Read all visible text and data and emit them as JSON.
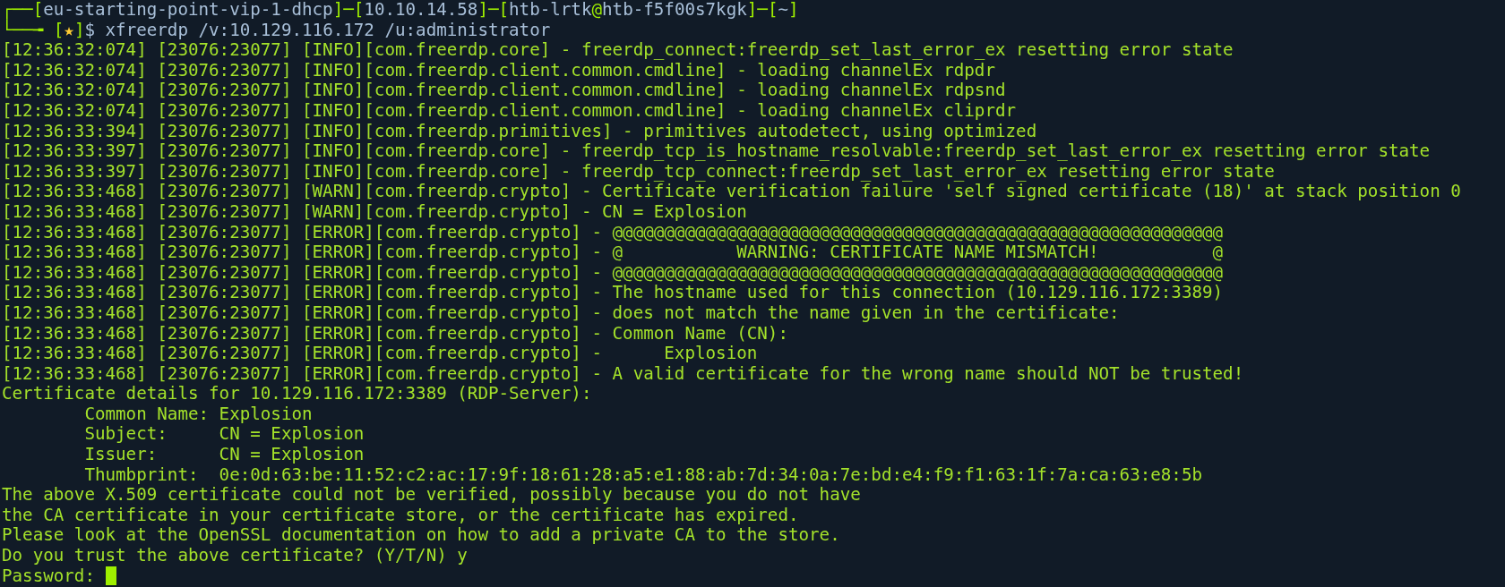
{
  "prompt": [
    [
      {
        "kind": "frame",
        "text": "┌──["
      },
      {
        "kind": "value",
        "text": "eu-starting-point-vip-1-dhcp"
      },
      {
        "kind": "frame",
        "text": "]─["
      },
      {
        "kind": "value",
        "text": "10.10.14.58"
      },
      {
        "kind": "frame",
        "text": "]─["
      },
      {
        "kind": "value",
        "text": "htb-lrtk"
      },
      {
        "kind": "frame",
        "text": "@"
      },
      {
        "kind": "value",
        "text": "htb-f5f00s7kgk"
      },
      {
        "kind": "frame",
        "text": "]─["
      },
      {
        "kind": "value",
        "text": "~"
      },
      {
        "kind": "frame",
        "text": "]"
      }
    ],
    [
      {
        "kind": "frame",
        "text": "└──╼ ["
      },
      {
        "kind": "star",
        "text": "★"
      },
      {
        "kind": "frame",
        "text": "]"
      },
      {
        "kind": "value",
        "text": "$ xfreerdp /v:10.129.116.172 /u:administrator"
      }
    ]
  ],
  "lines": [
    "[12:36:32:074] [23076:23077] [INFO][com.freerdp.core] - freerdp_connect:freerdp_set_last_error_ex resetting error state",
    "[12:36:32:074] [23076:23077] [INFO][com.freerdp.client.common.cmdline] - loading channelEx rdpdr",
    "[12:36:32:074] [23076:23077] [INFO][com.freerdp.client.common.cmdline] - loading channelEx rdpsnd",
    "[12:36:32:074] [23076:23077] [INFO][com.freerdp.client.common.cmdline] - loading channelEx cliprdr",
    "[12:36:33:394] [23076:23077] [INFO][com.freerdp.primitives] - primitives autodetect, using optimized",
    "[12:36:33:397] [23076:23077] [INFO][com.freerdp.core] - freerdp_tcp_is_hostname_resolvable:freerdp_set_last_error_ex resetting error state",
    "[12:36:33:397] [23076:23077] [INFO][com.freerdp.core] - freerdp_tcp_connect:freerdp_set_last_error_ex resetting error state",
    "[12:36:33:468] [23076:23077] [WARN][com.freerdp.crypto] - Certificate verification failure 'self signed certificate (18)' at stack position 0",
    "[12:36:33:468] [23076:23077] [WARN][com.freerdp.crypto] - CN = Explosion",
    "[12:36:33:468] [23076:23077] [ERROR][com.freerdp.crypto] - @@@@@@@@@@@@@@@@@@@@@@@@@@@@@@@@@@@@@@@@@@@@@@@@@@@@@@@@@@@",
    "[12:36:33:468] [23076:23077] [ERROR][com.freerdp.crypto] - @           WARNING: CERTIFICATE NAME MISMATCH!           @",
    "[12:36:33:468] [23076:23077] [ERROR][com.freerdp.crypto] - @@@@@@@@@@@@@@@@@@@@@@@@@@@@@@@@@@@@@@@@@@@@@@@@@@@@@@@@@@@",
    "[12:36:33:468] [23076:23077] [ERROR][com.freerdp.crypto] - The hostname used for this connection (10.129.116.172:3389)",
    "[12:36:33:468] [23076:23077] [ERROR][com.freerdp.crypto] - does not match the name given in the certificate:",
    "[12:36:33:468] [23076:23077] [ERROR][com.freerdp.crypto] - Common Name (CN):",
    "[12:36:33:468] [23076:23077] [ERROR][com.freerdp.crypto] -      Explosion",
    "[12:36:33:468] [23076:23077] [ERROR][com.freerdp.crypto] - A valid certificate for the wrong name should NOT be trusted!",
    "Certificate details for 10.129.116.172:3389 (RDP-Server):",
    "        Common Name: Explosion",
    "        Subject:     CN = Explosion",
    "        Issuer:      CN = Explosion",
    "        Thumbprint:  0e:0d:63:be:11:52:c2:ac:17:9f:18:61:28:a5:e1:88:ab:7d:34:0a:7e:bd:e4:f9:f1:63:1f:7a:ca:63:e8:5b",
    "The above X.509 certificate could not be verified, possibly because you do not have",
    "the CA certificate in your certificate store, or the certificate has expired.",
    "Please look at the OpenSSL documentation on how to add a private CA to the store.",
    "Do you trust the above certificate? (Y/T/N) y"
  ],
  "input": {
    "label": "Password:",
    "cursor": true
  }
}
